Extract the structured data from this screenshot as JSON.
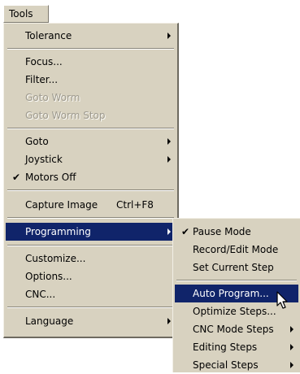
{
  "menubar": {
    "tools_label": "Tools"
  },
  "tools_menu": {
    "tolerance": "Tolerance",
    "focus": "Focus...",
    "filter": "Filter...",
    "goto_worm": "Goto Worm",
    "goto_worm_stop": "Goto Worm Stop",
    "goto": "Goto",
    "joystick": "Joystick",
    "motors_off": "Motors Off",
    "capture_image": "Capture Image",
    "capture_shortcut": "Ctrl+F8",
    "programming": "Programming",
    "customize": "Customize...",
    "options": "Options...",
    "cnc": "CNC...",
    "language": "Language"
  },
  "programming_menu": {
    "pause_mode": "Pause Mode",
    "record_edit_mode": "Record/Edit Mode",
    "set_current_step": "Set Current Step",
    "auto_program": "Auto Program...",
    "optimize_steps": "Optimize Steps...",
    "cnc_mode_steps": "CNC Mode Steps",
    "editing_steps": "Editing Steps",
    "special_steps": "Special Steps"
  },
  "check_glyph": "✔",
  "icons": {
    "submenu": "chevron-right-icon",
    "check": "check-icon",
    "cursor": "mouse-pointer-icon"
  },
  "colors": {
    "menu_bg": "#d8d2c0",
    "highlight": "#10246a",
    "disabled_text": "#9e9a8e"
  }
}
